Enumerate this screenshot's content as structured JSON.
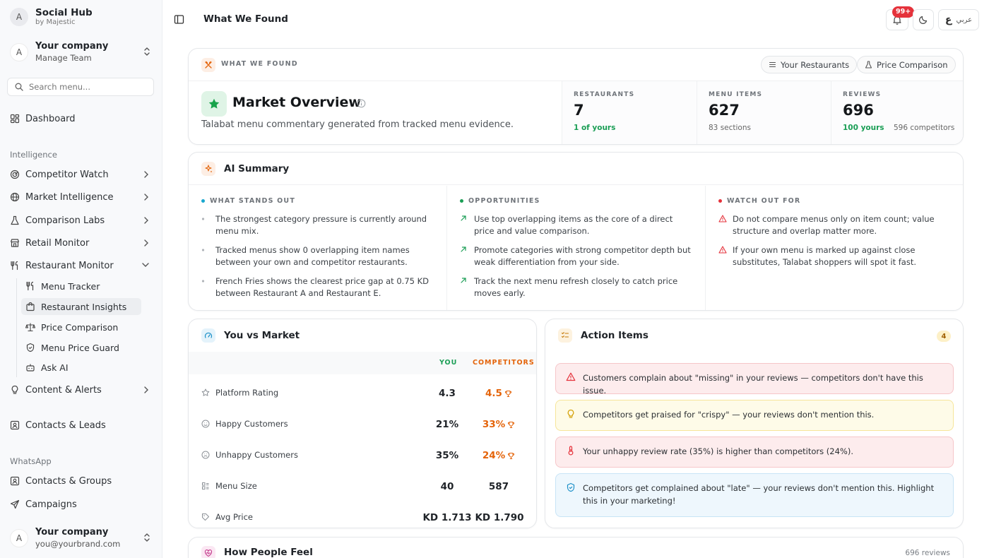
{
  "sidebar": {
    "brand_initial": "A",
    "brand_title": "Social Hub",
    "brand_sub": "by Majestic",
    "company_initial": "A",
    "company_name": "Your company",
    "company_sub": "Manage Team",
    "search_placeholder": "Search menu...",
    "dashboard": "Dashboard",
    "section_intelligence": "Intelligence",
    "items": [
      {
        "label": "Competitor Watch",
        "icon": "radar-icon"
      },
      {
        "label": "Market Intelligence",
        "icon": "globe-icon"
      },
      {
        "label": "Comparison Labs",
        "icon": "flask-icon"
      },
      {
        "label": "Retail Monitor",
        "icon": "store-icon"
      },
      {
        "label": "Restaurant Monitor",
        "icon": "utensils-icon"
      }
    ],
    "sub_items": [
      {
        "label": "Menu Tracker",
        "icon": "utensils-icon"
      },
      {
        "label": "Restaurant Insights",
        "icon": "shopping-bag-icon"
      },
      {
        "label": "Price Comparison",
        "icon": "scale-icon"
      },
      {
        "label": "Menu Price Guard",
        "icon": "shield-icon"
      },
      {
        "label": "Ask AI",
        "icon": "bot-icon"
      }
    ],
    "content_alerts": "Content & Alerts",
    "contacts_leads": "Contacts & Leads",
    "section_whatsapp": "WhatsApp",
    "contacts_groups": "Contacts & Groups",
    "campaigns": "Campaigns",
    "footer_initial": "A",
    "footer_name": "Your company",
    "footer_email": "you@yourbrand.com"
  },
  "topbar": {
    "title": "What We Found",
    "notification_count": "99+",
    "lang_glyph": "ع",
    "lang_label": "عربي"
  },
  "what_we_found": {
    "kicker": "WHAT WE FOUND",
    "btn_restaurants": "Your Restaurants",
    "btn_price": "Price Comparison",
    "title": "Market Overview",
    "subtitle": "Talabat menu commentary generated from tracked menu evidence.",
    "stats": [
      {
        "kicker": "RESTAURANTS",
        "value": "7",
        "sub1": "1 of yours",
        "sub2": ""
      },
      {
        "kicker": "MENU ITEMS",
        "value": "627",
        "sub1": "83 sections",
        "sub2": ""
      },
      {
        "kicker": "REVIEWS",
        "value": "696",
        "sub1": "100 yours",
        "sub2": "596 competitors"
      }
    ]
  },
  "ai_summary": {
    "title": "AI Summary",
    "columns": [
      {
        "heading": "WHAT STANDS OUT",
        "color": "#19a7ce",
        "items": [
          "The strongest category pressure is currently around menu mix.",
          "Tracked menus show 0 overlapping item names between your own and competitor restaurants.",
          "French Fries shows the clearest price gap at 0.75 KD between Restaurant A and Restaurant E."
        ]
      },
      {
        "heading": "OPPORTUNITIES",
        "color": "#1a9e55",
        "items": [
          "Use top overlapping items as the core of a direct price and value comparison.",
          "Promote categories with strong competitor depth but weak differentiation from your side.",
          "Track the next menu refresh closely to catch price moves early."
        ]
      },
      {
        "heading": "WATCH OUT FOR",
        "color": "#e5323b",
        "items": [
          "Do not compare menus only on item count; value structure and overlap matter more.",
          "If your own menu is marked up against close substitutes, Talabat shoppers will spot it fast."
        ]
      }
    ]
  },
  "you_vs_market": {
    "title": "You vs Market",
    "col_you": "YOU",
    "col_comp": "COMPETITORS",
    "rows": [
      {
        "label": "Platform Rating",
        "icon": "star-icon",
        "you": "4.3",
        "comp": "4.5"
      },
      {
        "label": "Happy Customers",
        "icon": "smile-icon",
        "you": "21%",
        "comp": "33%"
      },
      {
        "label": "Unhappy Customers",
        "icon": "frown-icon",
        "you": "35%",
        "comp": "24%"
      },
      {
        "label": "Menu Size",
        "icon": "grid-icon",
        "you": "40",
        "comp": "587"
      },
      {
        "label": "Avg Price",
        "icon": "tag-icon",
        "you": "KD 1.713",
        "comp": "KD 1.790"
      }
    ]
  },
  "action_items": {
    "title": "Action Items",
    "count": "4",
    "items": [
      {
        "kind": "red",
        "icon": "warning-icon",
        "text": "Customers complain about \"missing\" in your reviews — competitors don't have this issue."
      },
      {
        "kind": "yellow",
        "icon": "lightbulb-icon",
        "text": "Competitors get praised for \"crispy\" — your reviews don't mention this."
      },
      {
        "kind": "red",
        "icon": "thermometer-icon",
        "text": "Your unhappy review rate (35%) is higher than competitors (24%)."
      },
      {
        "kind": "blue",
        "icon": "shield-check-icon",
        "text": "Competitors get complained about \"late\" — your reviews don't mention this. Highlight this in your marketing!"
      }
    ]
  },
  "how_people_feel": {
    "title": "How People Feel",
    "meta": "696 reviews"
  },
  "colors": {
    "accent_green": "#1a9e55",
    "accent_orange": "#e4640a",
    "alert_red": "#e5323b"
  }
}
